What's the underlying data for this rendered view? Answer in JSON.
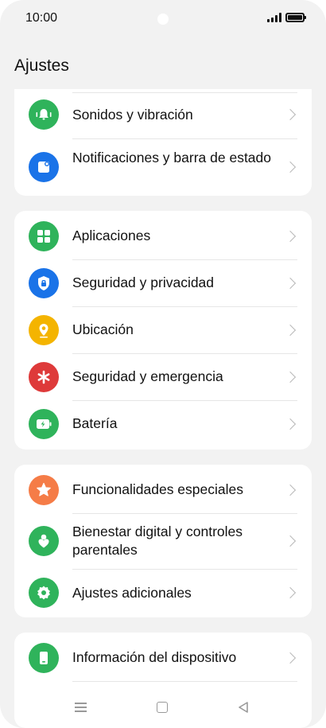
{
  "status_bar": {
    "time": "10:00"
  },
  "header": {
    "title": "Ajustes"
  },
  "colors": {
    "green": "#2fb35b",
    "blue": "#1a73e8",
    "amber": "#f4b400",
    "red": "#de3a3a",
    "orange": "#f57c47"
  },
  "groups": [
    {
      "items": [
        {
          "label": "Sonidos y vibración",
          "icon": "bell-vibrate-icon"
        },
        {
          "label": "Notificaciones y barra de estado",
          "icon": "notification-icon"
        }
      ]
    },
    {
      "items": [
        {
          "label": "Aplicaciones",
          "icon": "apps-grid-icon"
        },
        {
          "label": "Seguridad y privacidad",
          "icon": "shield-lock-icon"
        },
        {
          "label": "Ubicación",
          "icon": "location-pin-icon"
        },
        {
          "label": "Seguridad y emergencia",
          "icon": "asterisk-icon"
        },
        {
          "label": "Batería",
          "icon": "battery-icon"
        }
      ]
    },
    {
      "items": [
        {
          "label": "Funcionalidades especiales",
          "icon": "star-icon"
        },
        {
          "label": "Bienestar digital y controles parentales",
          "icon": "wellbeing-icon"
        },
        {
          "label": "Ajustes adicionales",
          "icon": "gear-icon"
        }
      ]
    },
    {
      "items": [
        {
          "label": "Información del dispositivo",
          "icon": "phone-device-icon"
        }
      ]
    }
  ],
  "nav_bar": {
    "menu_icon": "menu-icon",
    "home_icon": "home-icon",
    "back_icon": "back-icon"
  }
}
